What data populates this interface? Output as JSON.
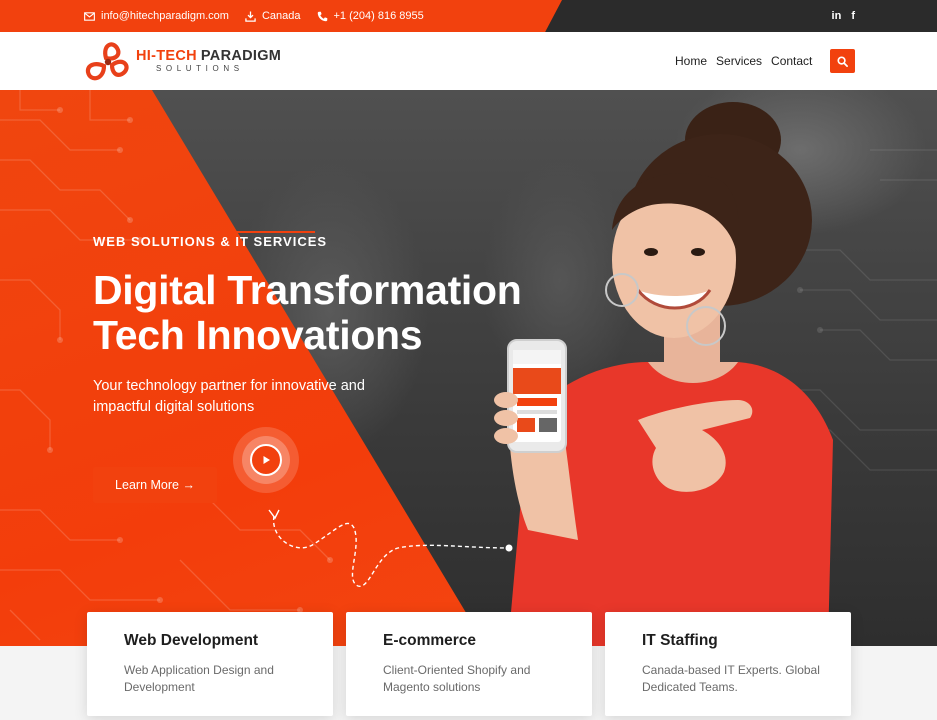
{
  "topbar": {
    "email": "info@hitechparadigm.com",
    "location": "Canada",
    "phone": "+1 (204) 816 8955",
    "social": {
      "linkedin": "in",
      "facebook": "f"
    }
  },
  "brand": {
    "name_accent": "HI-TECH",
    "name_rest": "PARADIGM",
    "tagline": "SOLUTIONS"
  },
  "nav": {
    "items": [
      "Home",
      "Services",
      "Contact"
    ]
  },
  "hero": {
    "tag": "WEB SOLUTIONS & IT SERVICES",
    "title_line1": "Digital Transformation",
    "title_line2": "Tech Innovations",
    "subtitle": "Your technology partner for innovative and impactful digital solutions",
    "cta_label": "Learn More →"
  },
  "cards": [
    {
      "title": "Web Development",
      "description": "Web Application Design and Development"
    },
    {
      "title": "E-commerce",
      "description": "Client-Oriented Shopify and Magento solutions"
    },
    {
      "title": "IT Staffing",
      "description": "Canada-based IT Experts. Global Dedicated Teams."
    }
  ],
  "colors": {
    "accent": "#f2410e",
    "dark": "#2b2b2b",
    "text": "#1e1e1e"
  },
  "icons": [
    "envelope-icon",
    "download-icon",
    "phone-icon",
    "linkedin-icon",
    "facebook-icon",
    "search-icon",
    "play-icon"
  ]
}
